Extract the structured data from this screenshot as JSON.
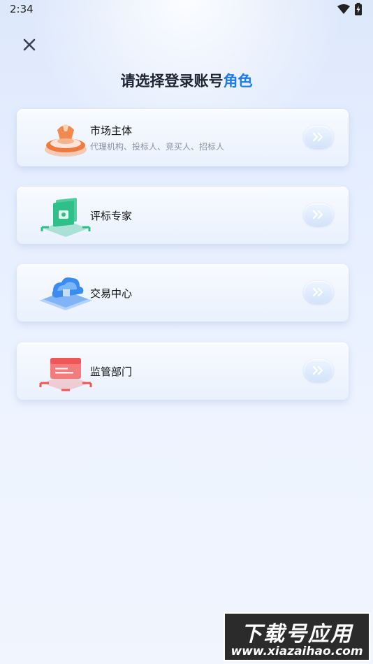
{
  "status": {
    "time": "2:34"
  },
  "header": {
    "title_main": "请选择登录账号",
    "title_accent": "角色"
  },
  "roles": [
    {
      "title": "市场主体",
      "subtitle": "代理机构、投标人、竞买人、招标人",
      "icon": "market-entity-icon"
    },
    {
      "title": "评标专家",
      "icon": "bid-expert-icon"
    },
    {
      "title": "交易中心",
      "icon": "trading-center-icon"
    },
    {
      "title": "监管部门",
      "icon": "regulator-icon"
    }
  ],
  "watermark": {
    "title": "下载号应用",
    "url": "www.xiazaihao.com"
  },
  "colors": {
    "accent": "#1f7be9",
    "orange": "#f07a3e",
    "green": "#2fbf8a",
    "blue": "#3b8cf0",
    "red": "#ef5656"
  }
}
